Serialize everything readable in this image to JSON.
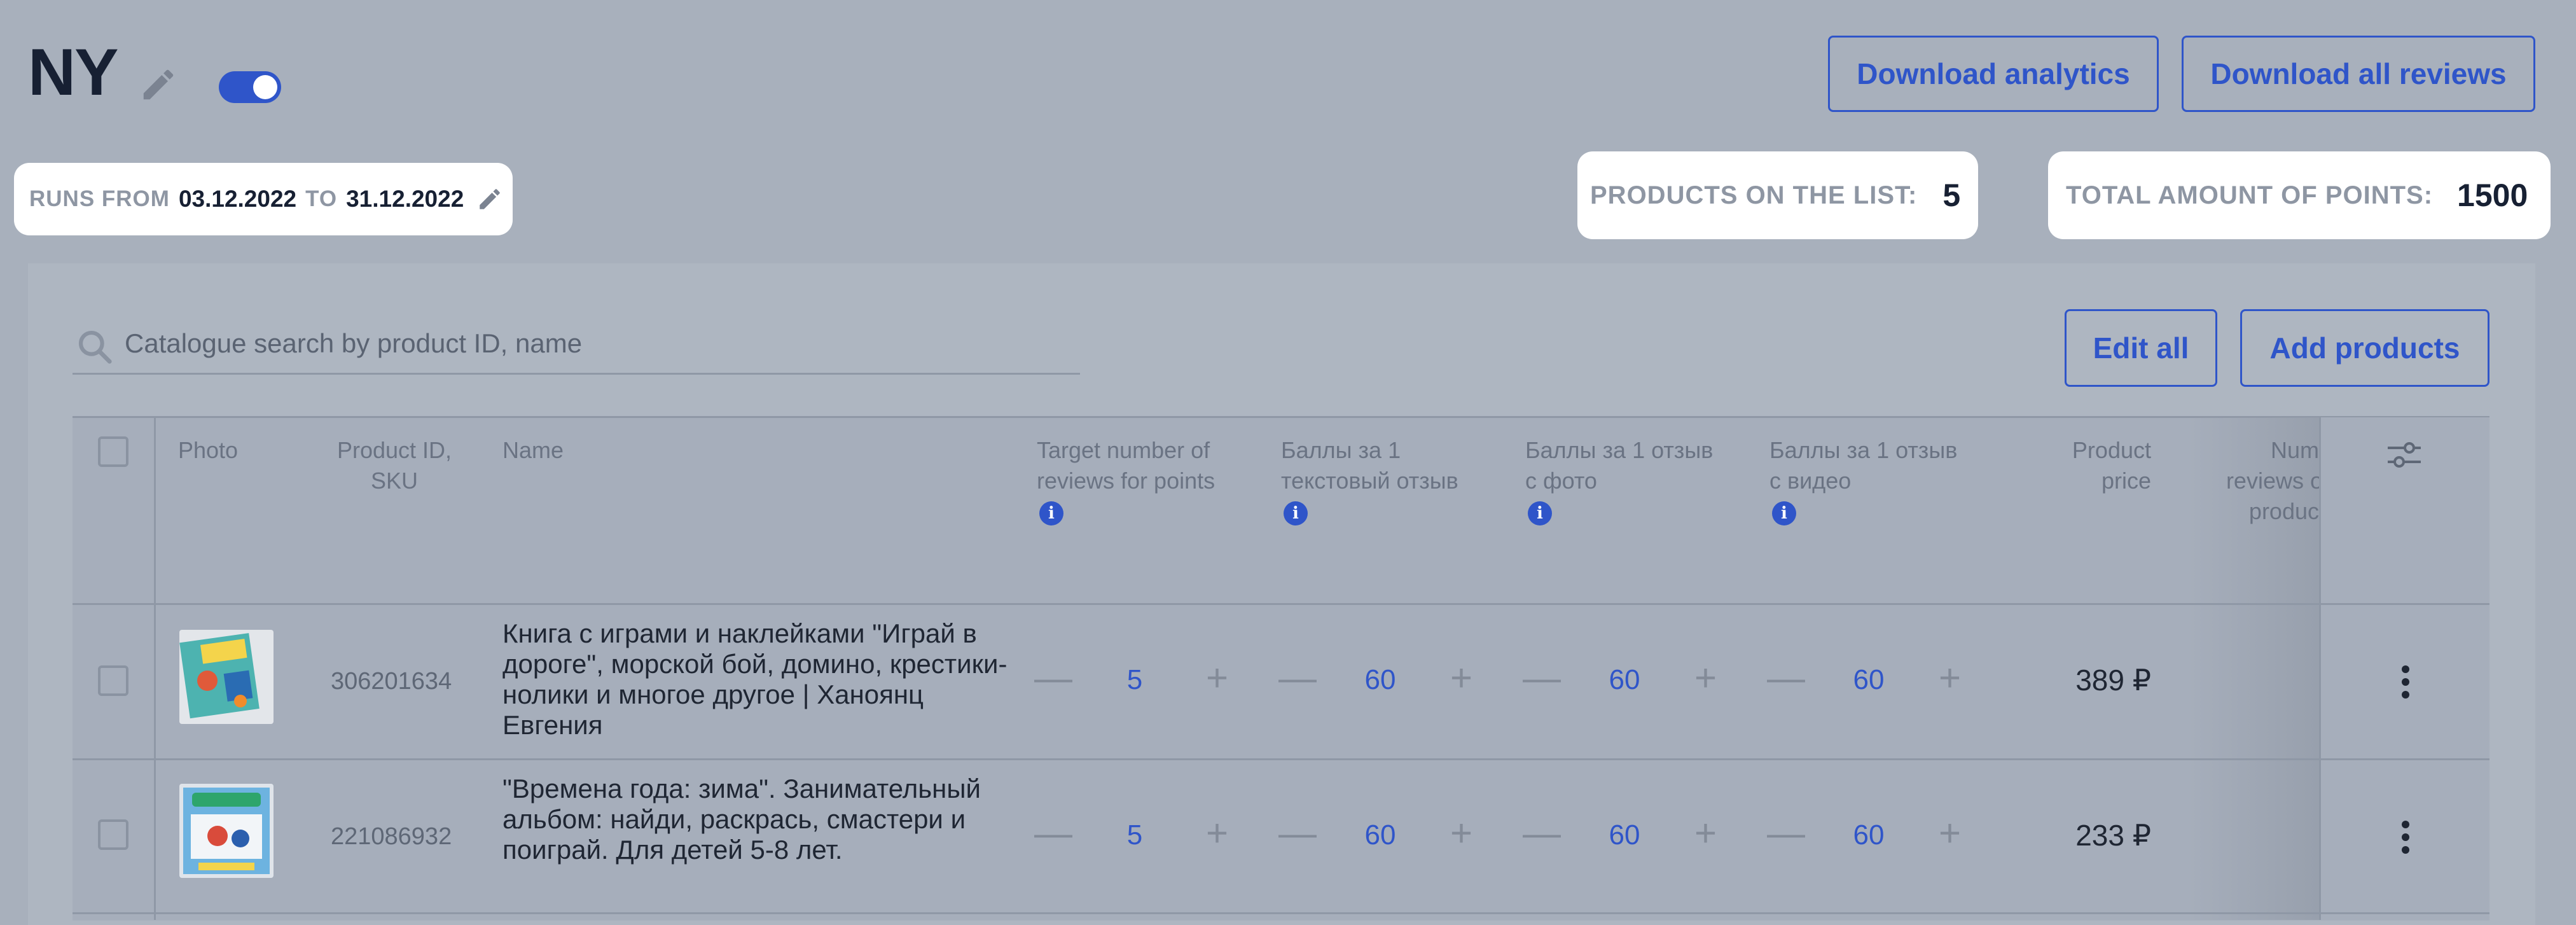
{
  "header": {
    "title": "NY",
    "download_analytics": "Download analytics",
    "download_all_reviews": "Download all reviews",
    "toggle_on": true
  },
  "runs": {
    "from_label": "RUNS FROM",
    "from_date": "03.12.2022",
    "to_label": "TO",
    "to_date": "31.12.2022"
  },
  "stats": {
    "products_label": "PRODUCTS ON THE LIST:",
    "products_value": "5",
    "points_label": "TOTAL AMOUNT OF POINTS:",
    "points_value": "1500"
  },
  "toolbar": {
    "search_placeholder": "Catalogue search by product ID, name",
    "edit_all": "Edit all",
    "add_products": "Add products"
  },
  "table": {
    "columns": {
      "photo": "Photo",
      "product_id_1": "Product ID,",
      "product_id_2": "SKU",
      "name": "Name",
      "target_1": "Target number of",
      "target_2": "reviews for points",
      "text_1": "Баллы за 1",
      "text_2": "текстовый отзыв",
      "photo_review_1": "Баллы за 1 отзыв",
      "photo_review_2": "с фото",
      "video_review_1": "Баллы за 1 отзыв",
      "video_review_2": "с видео",
      "price_1": "Product",
      "price_2": "price",
      "num_1": "Numb",
      "num_2": "reviews o",
      "num_3": "product"
    },
    "rows": [
      {
        "sku": "306201634",
        "name": "Книга с играми и наклейками \"Играй в дороге\", морской бой, домино, крестики-нолики и многое другое | Ханоянц Евгения",
        "target": "5",
        "text_points": "60",
        "photo_points": "60",
        "video_points": "60",
        "price": "389 ₽"
      },
      {
        "sku": "221086932",
        "name": "\"Времена года: зима\". Занимательный альбом: найди, раскрась, смастери и поиграй. Для детей 5-8 лет.",
        "target": "5",
        "text_points": "60",
        "photo_points": "60",
        "video_points": "60",
        "price": "233 ₽"
      }
    ]
  },
  "colors": {
    "accent": "#2f55c9",
    "background": "#a8b0bc"
  },
  "icons": {
    "edit": "pencil-icon",
    "search": "search-icon",
    "info": "info-icon",
    "settings": "sliders-icon",
    "more": "kebab-icon"
  }
}
